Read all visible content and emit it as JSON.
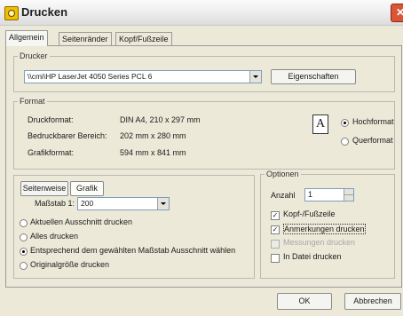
{
  "window": {
    "title": "Drucken"
  },
  "tabs": [
    "Allgemein",
    "Seitenränder",
    "Kopf/Fußzeile"
  ],
  "drucker": {
    "legend": "Drucker",
    "selected": "\\\\cmi\\HP LaserJet 4050 Series PCL 6",
    "properties_label": "Eigenschaften"
  },
  "format": {
    "legend": "Format",
    "rows": [
      {
        "label": "Druckformat:",
        "value": "DIN A4, 210 x 297 mm"
      },
      {
        "label": "Bedruckbarer Bereich:",
        "value": "202 mm x 280 mm"
      },
      {
        "label": "Grafikformat:",
        "value": "594 mm x 841 mm"
      }
    ],
    "orientation_glyph": "A",
    "orientation_options": [
      "Hochformat",
      "Querformat"
    ],
    "orientation_selected": "Hochformat"
  },
  "scale": {
    "buttons": [
      "Seitenweise",
      "Grafik"
    ],
    "label": "Maßstab 1:",
    "value": "200",
    "options": [
      "Aktuellen Ausschnitt drucken",
      "Alles drucken",
      "Entsprechend dem gewählten Maßstab Ausschnitt wählen",
      "Originalgröße drucken"
    ],
    "selected_index": 2
  },
  "optionen": {
    "legend": "Optionen",
    "count_label": "Anzahl",
    "count": "1",
    "checks": [
      {
        "label": "Kopf-/Fußzeile",
        "checked": true,
        "enabled": true
      },
      {
        "label": "Anmerkungen drucken",
        "checked": true,
        "enabled": true
      },
      {
        "label": "Messungen drucken",
        "checked": false,
        "enabled": false
      },
      {
        "label": "In Datei drucken",
        "checked": false,
        "enabled": true
      }
    ]
  },
  "footer": {
    "ok": "OK",
    "cancel": "Abbrechen"
  }
}
